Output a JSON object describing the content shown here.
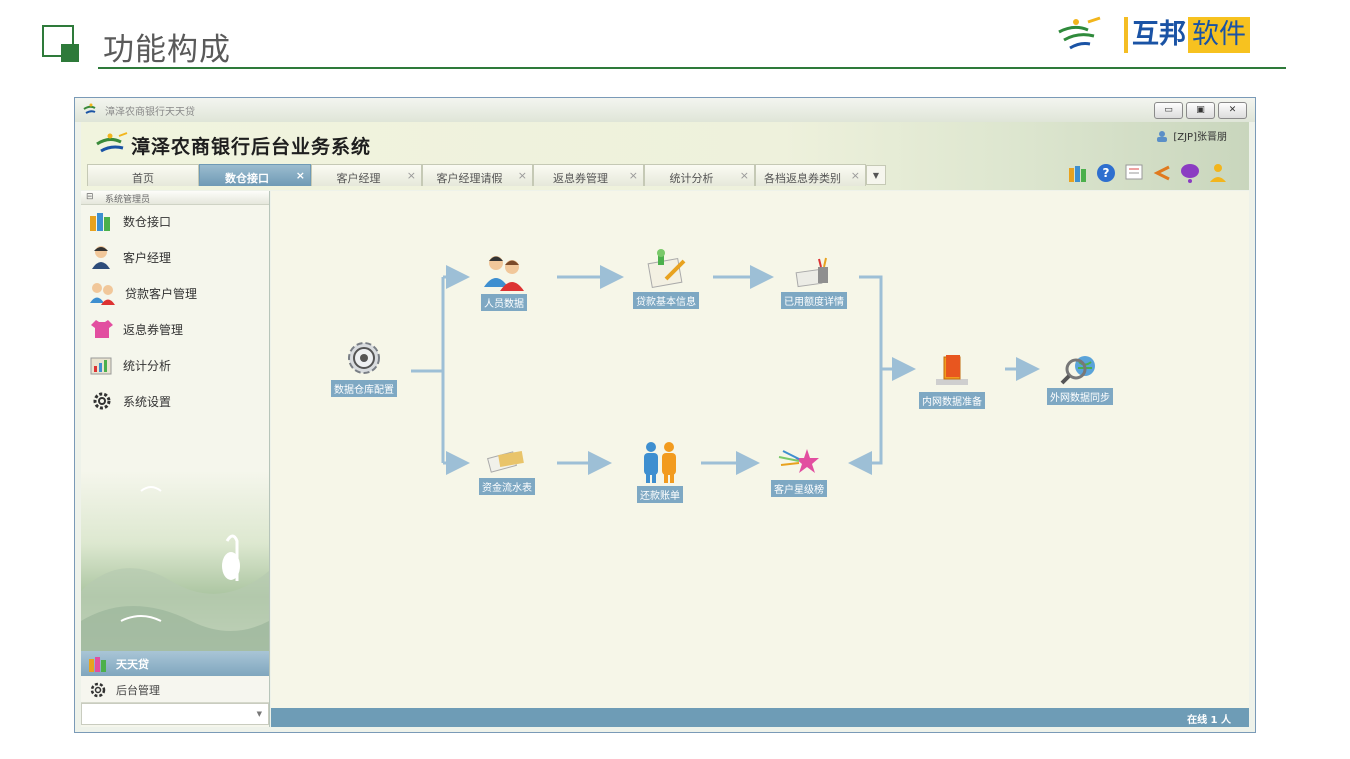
{
  "slide": {
    "title": "功能构成",
    "brand_a": "互邦",
    "brand_b": "软件",
    "accent": "#2e7a3a"
  },
  "window": {
    "title": "漳泽农商银行天天贷",
    "min_icon": "minimize-icon",
    "max_icon": "restore-icon",
    "close_icon": "close-icon"
  },
  "app": {
    "title": "漳泽农商银行后台业务系统",
    "user": "[ZJP]张晋朋",
    "tabs": [
      {
        "label": "首页",
        "closable": false
      },
      {
        "label": "数仓接口",
        "closable": true,
        "active": true
      },
      {
        "label": "客户经理",
        "closable": true
      },
      {
        "label": "客户经理请假",
        "closable": true
      },
      {
        "label": "返息券管理",
        "closable": true
      },
      {
        "label": "统计分析",
        "closable": true
      },
      {
        "label": "各档返息券类别",
        "closable": true
      }
    ],
    "tab_close": "×"
  },
  "sidebar": {
    "header": "系统管理员",
    "items": [
      {
        "label": "数仓接口",
        "icon": "books-icon"
      },
      {
        "label": "客户经理",
        "icon": "person-icon"
      },
      {
        "label": "贷款客户管理",
        "icon": "group-icon"
      },
      {
        "label": "返息券管理",
        "icon": "shirt-icon"
      },
      {
        "label": "统计分析",
        "icon": "chart-icon"
      },
      {
        "label": "系统设置",
        "icon": "gear-icon"
      }
    ],
    "bottom_active": "天天贷",
    "bottom_item": "后台管理"
  },
  "flow": {
    "nodes": {
      "warehouse": "数据仓库配置",
      "personnel": "人员数据",
      "loan_info": "贷款基本信息",
      "quota": "已用额度详情",
      "cashflow": "资金流水表",
      "repay": "还款账单",
      "rating": "客户星级榜",
      "intranet": "内网数据准备",
      "extranet": "外网数据同步"
    }
  },
  "status": {
    "online": "在线 1 人"
  }
}
